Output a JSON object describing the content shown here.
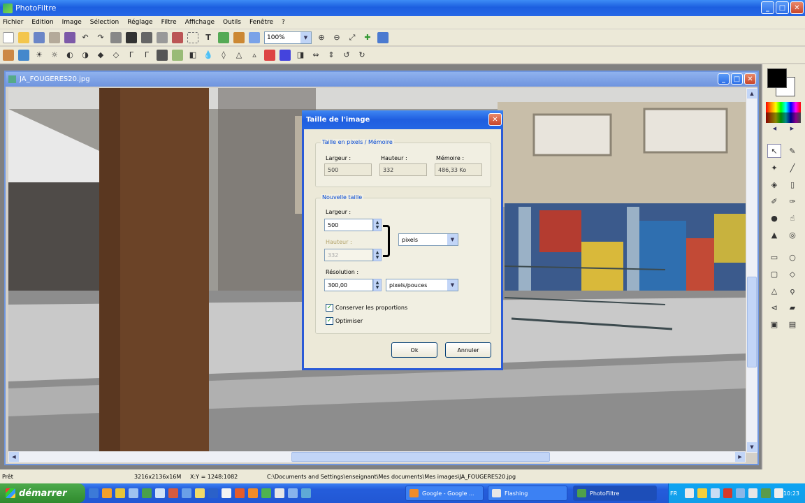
{
  "app": {
    "title": "PhotoFiltre"
  },
  "menu": [
    "Fichier",
    "Edition",
    "Image",
    "Sélection",
    "Réglage",
    "Filtre",
    "Affichage",
    "Outils",
    "Fenêtre",
    "?"
  ],
  "toolbar": {
    "zoom": "100%"
  },
  "document": {
    "title": "JA_FOUGERES20.jpg"
  },
  "dialog": {
    "title": "Taille de l'image",
    "current": {
      "legend": "Taille en pixels / Mémoire",
      "width_label": "Largeur :",
      "width_value": "500",
      "height_label": "Hauteur :",
      "height_value": "332",
      "memory_label": "Mémoire :",
      "memory_value": "486,33 Ko"
    },
    "new": {
      "legend": "Nouvelle taille",
      "width_label": "Largeur :",
      "width_value": "500",
      "height_label": "Hauteur :",
      "height_value": "332",
      "unit": "pixels",
      "resolution_label": "Résolution :",
      "resolution_value": "300,00",
      "resolution_unit": "pixels/pouces"
    },
    "keep_proportions": "Conserver les proportions",
    "optimize": "Optimiser",
    "ok": "Ok",
    "cancel": "Annuler"
  },
  "status": {
    "left": "Prêt",
    "size": "3216x2136x16M",
    "coords": "X:Y = 1248:1082",
    "path": "C:\\Documents and Settings\\enseignant\\Mes documents\\Mes images\\JA_FOUGERES20.jpg"
  },
  "taskbar": {
    "start": "démarrer",
    "tasks": [
      "Google - Google ...",
      "Flashing",
      "PhotoFiltre"
    ],
    "lang": "FR",
    "time": "10:23"
  }
}
